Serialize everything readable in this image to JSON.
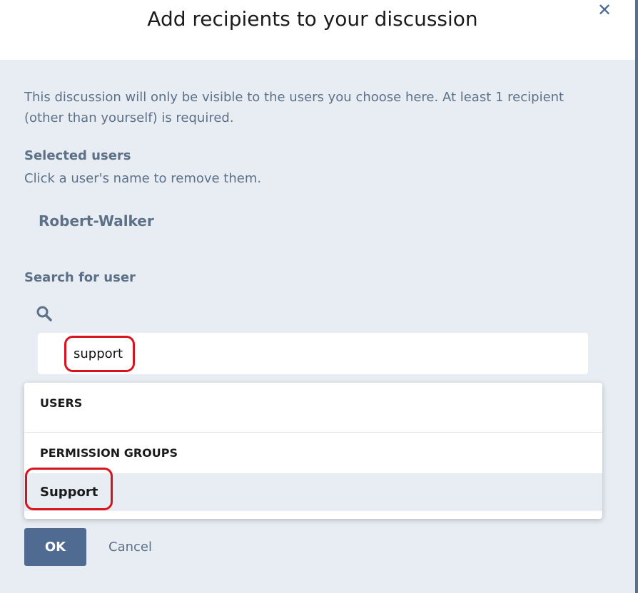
{
  "dialog": {
    "title": "Add recipients to your discussion",
    "close_icon": "close-icon"
  },
  "intro_text": "This discussion will only be visible to the users you choose here. At least 1 recipient (other than yourself) is required.",
  "selected": {
    "title": "Selected users",
    "hint": "Click a user's name to remove them.",
    "users": [
      "Robert-Walker"
    ]
  },
  "search": {
    "title": "Search for user",
    "icon": "search-icon",
    "value": "support",
    "placeholder": ""
  },
  "dropdown": {
    "users_header": "USERS",
    "groups_header": "PERMISSION GROUPS",
    "group_items": [
      "Support"
    ]
  },
  "actions": {
    "ok_label": "OK",
    "cancel_label": "Cancel"
  },
  "colors": {
    "accent": "#4f6b92",
    "muted_text": "#5c7087",
    "panel_bg": "#e8edf3",
    "callout": "#d9121c"
  }
}
